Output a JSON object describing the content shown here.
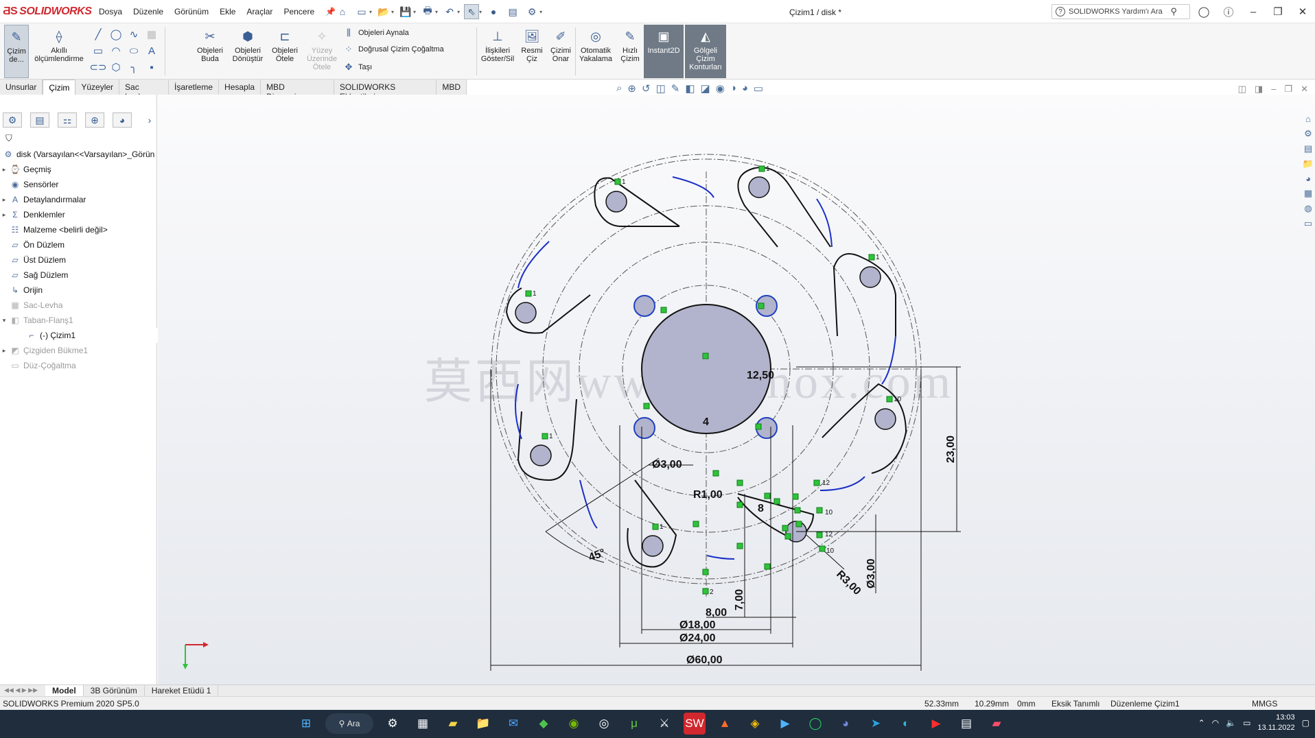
{
  "app": {
    "logo": "SOLIDWORKS",
    "doc_title": "Çizim1 / disk *",
    "help_search": "SOLIDWORKS Yardım'ı Ara"
  },
  "menu": [
    "Dosya",
    "Düzenle",
    "Görünüm",
    "Ekle",
    "Araçlar",
    "Pencere"
  ],
  "toolbar": {
    "sketch_btn": "Çizim de...",
    "smart_dim": "Akıllı ölçümlendirme",
    "trim": "Objeleri Buda",
    "convert": "Objeleri Dönüştür",
    "offset": "Objeleri Ötele",
    "surface_offset": "Yüzey Üzerinde Ötele",
    "mirror": "Objeleri Aynala",
    "linear_pattern": "Doğrusal Çizim Çoğaltma",
    "move": "Taşı",
    "relations": "İlişkileri Göster/Sil",
    "repair_pic": "Resmi Çiz",
    "repair": "Çizimi Onar",
    "snap": "Otomatik Yakalama",
    "rapid": "Hızlı Çizim",
    "instant2d": "Instant2D",
    "shaded": "Gölgeli Çizim Konturları"
  },
  "tabs": [
    "Unsurlar",
    "Çizim",
    "Yüzeyler",
    "Sac Levha",
    "İşaretleme",
    "Hesapla",
    "MBD Dimensions",
    "SOLIDWORKS Eklentileri",
    "MBD"
  ],
  "active_tab": "Çizim",
  "tree": {
    "root": "disk  (Varsayılan<<Varsayılan>_Görün",
    "items": [
      {
        "label": "Geçmiş"
      },
      {
        "label": "Sensörler"
      },
      {
        "label": "Detaylandırmalar"
      },
      {
        "label": "Denklemler"
      },
      {
        "label": "Malzeme <belirli değil>"
      },
      {
        "label": "Ön Düzlem"
      },
      {
        "label": "Üst Düzlem"
      },
      {
        "label": "Sağ Düzlem"
      },
      {
        "label": "Orijin"
      },
      {
        "label": "Sac-Levha"
      },
      {
        "label": "Taban-Flanş1"
      },
      {
        "label": "(-) Çizim1"
      },
      {
        "label": "Çizgiden Bükme1"
      },
      {
        "label": "Düz-Çoğaltma"
      }
    ]
  },
  "dims": {
    "d60": "Ø60,00",
    "d24": "Ø24,00",
    "d18": "Ø18,00",
    "d3a": "Ø3,00",
    "d3b": "Ø3,00",
    "r1": "R1,00",
    "r3": "R3,00",
    "v1250": "12,50",
    "v23": "23,00",
    "v8a": "8,00",
    "v7": "7,00",
    "ang": "45°",
    "n4": "4",
    "n8": "8"
  },
  "relation_labels": {
    "r1": "1",
    "r10": "10",
    "r12": "12",
    "r2": "2"
  },
  "watermark": "莫西网www.3dmox.com",
  "bottom_tabs": [
    "Model",
    "3B Görünüm",
    "Hareket Etüdü 1"
  ],
  "status": {
    "version": "SOLIDWORKS Premium 2020 SP5.0",
    "x": "52.33mm",
    "y": "10.29mm",
    "z": "0mm",
    "defined": "Eksik Tanımlı",
    "editing": "Düzenleme Çizim1",
    "units": "MMGS"
  },
  "taskbar": {
    "search": "Ara",
    "time": "13:03",
    "date": "13.11.2022"
  }
}
